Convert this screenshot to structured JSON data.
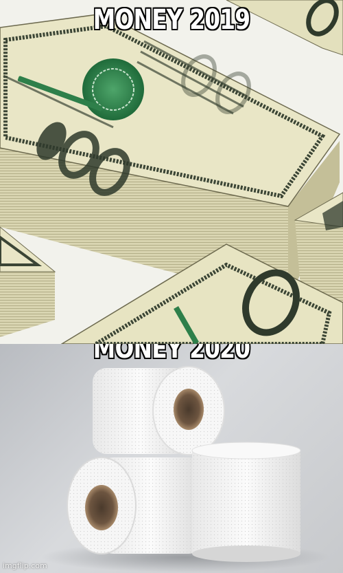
{
  "captions": {
    "top": "MONEY 2019",
    "bottom": "MONEY 2020"
  },
  "watermark": "imgflip.com",
  "colors": {
    "caption_text": "#ffffff",
    "caption_outline": "#000000",
    "bill_paper": "#e9e6c6",
    "bill_ink": "#2f3a2c",
    "seal_green": "#2f8a4e",
    "tissue": "#f4f4f4",
    "background_grey": "#c9cbce"
  },
  "panels": {
    "top": {
      "subject": "stacks-of-100-dollar-bills"
    },
    "bottom": {
      "subject": "three-toilet-paper-rolls"
    }
  }
}
